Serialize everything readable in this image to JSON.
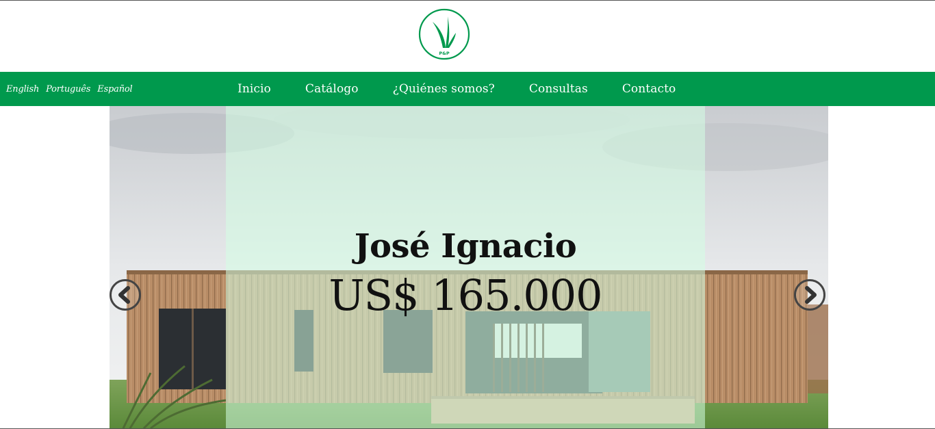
{
  "header": {
    "logo_text": "P&P"
  },
  "nav": {
    "languages": [
      "English",
      "Português",
      "Español"
    ],
    "menu": [
      "Inicio",
      "Catálogo",
      "¿Quiénes somos?",
      "Consultas",
      "Contacto"
    ]
  },
  "slide": {
    "title": "José Ignacio",
    "price": "US$ 165.000",
    "prev_icon": "chevron-left-icon",
    "next_icon": "chevron-right-icon"
  },
  "colors": {
    "brand_green": "#00994d",
    "overlay": "#d4ffe4"
  }
}
